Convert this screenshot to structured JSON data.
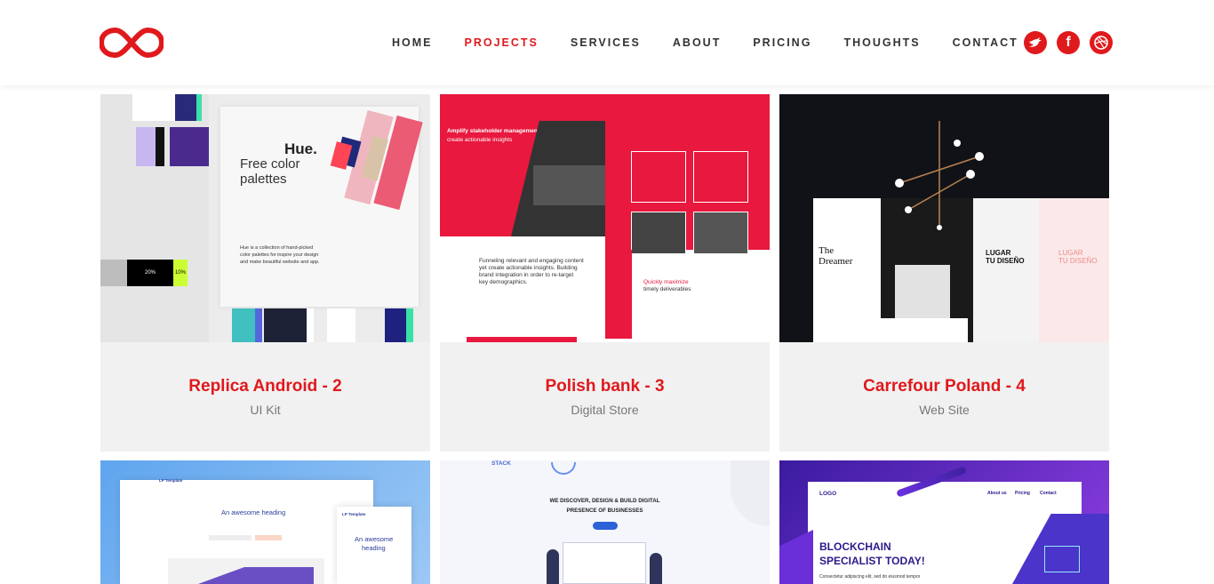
{
  "brand": {
    "accent": "#e0191d",
    "logo": "infinity-logo"
  },
  "nav": {
    "items": [
      {
        "label": "HOME"
      },
      {
        "label": "PROJECTS"
      },
      {
        "label": "SERVICES"
      },
      {
        "label": "ABOUT"
      },
      {
        "label": "PRICING"
      },
      {
        "label": "THOUGHTS"
      },
      {
        "label": "CONTACT"
      }
    ],
    "active": "PROJECTS"
  },
  "socials": [
    {
      "icon": "twitter-bird-icon"
    },
    {
      "icon": "facebook-icon",
      "glyph": "f"
    },
    {
      "icon": "dribbble-icon"
    }
  ],
  "projects": [
    {
      "title": "Replica Android - 2",
      "subtitle": "UI Kit",
      "thumb_text": {
        "heading": "Hue.",
        "line1": "Free color",
        "line2": "palettes",
        "body1": "Hue is a collection of hand-picked",
        "body2": "color palettes for inspire your design",
        "body3": "and make beautiful website and app.",
        "p1": "20%",
        "p2": "10%"
      }
    },
    {
      "title": "Polish bank - 3",
      "subtitle": "Digital Store",
      "thumb_text": {
        "hero1": "Amplify stakeholder management",
        "hero2": "create actionable insights",
        "body1": "Funneling relevant and engaging content",
        "body2": "yet create actionable insights. Building",
        "body3": "brand integration in order to re-target",
        "body4": "key demographics.",
        "side1": "Quickly maximize",
        "side2": "timely deliverables"
      }
    },
    {
      "title": "Carrefour Poland - 4",
      "subtitle": "Web Site",
      "thumb_text": {
        "left1": "The",
        "left2": "Dreamer",
        "right1": "LUGAR",
        "right2": "TU DISEÑO"
      }
    },
    {
      "title": "",
      "subtitle": "",
      "thumb_text": {
        "nav": "LP Template",
        "heading": "An awesome heading",
        "phone_brand": "LP Template",
        "phone1": "An awesome",
        "phone2": "heading"
      }
    },
    {
      "title": "",
      "subtitle": "",
      "thumb_text": {
        "logo": "STACK",
        "line1": "WE DISCOVER, DESIGN & BUILD DIGITAL",
        "line2": "PRESENCE OF BUSINESSES"
      }
    },
    {
      "title": "",
      "subtitle": "",
      "thumb_text": {
        "logo": "LOGO",
        "nav1": "About us",
        "nav2": "Pricing",
        "nav3": "Contact",
        "h1": "BLOCKCHAIN",
        "h2": "SPECIALIST TODAY!",
        "body": "Consectetur adipiscing elit, sed do eiusmod tempor"
      }
    }
  ]
}
